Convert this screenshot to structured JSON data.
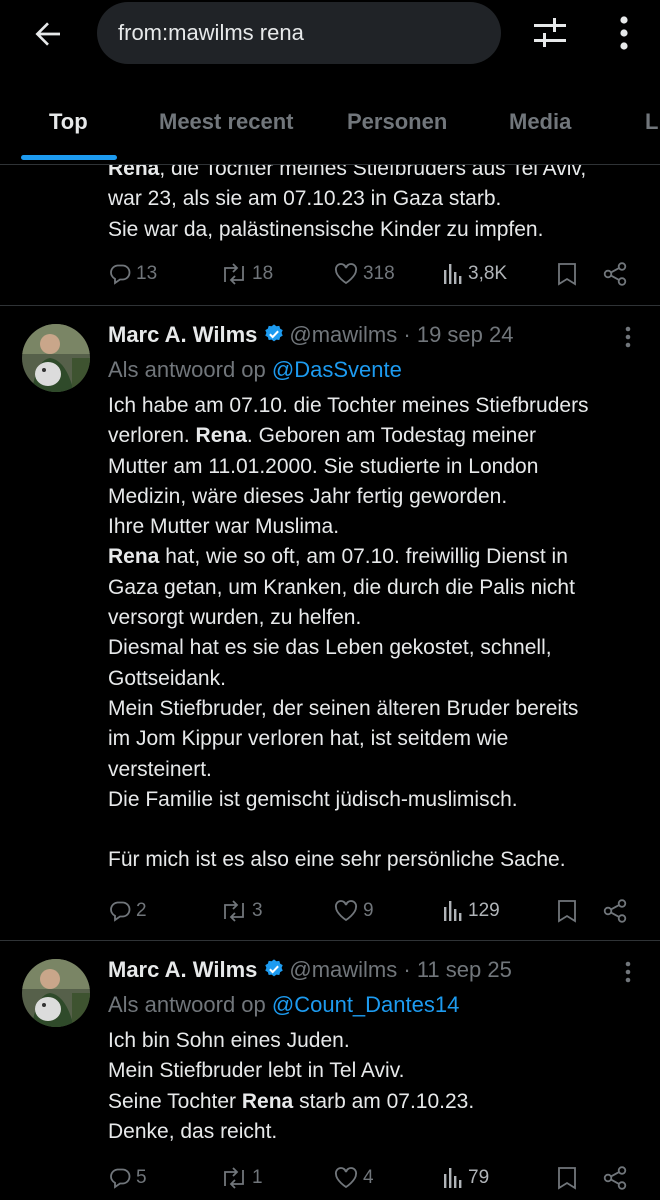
{
  "search": {
    "query": "from:mawilms rena"
  },
  "tabs": [
    {
      "label": "Top"
    },
    {
      "label": "Meest recent"
    },
    {
      "label": "Personen"
    },
    {
      "label": "Media"
    },
    {
      "label": "Li"
    }
  ],
  "tweet0": {
    "lines": [
      {
        "bold": "Rena",
        "rest": ", die Tochter meines Stiefbruders aus Tel Aviv,"
      },
      {
        "text": "war 23, als sie am 07.10.23 in Gaza starb."
      },
      {
        "text": "Sie war da, palästinensische Kinder zu impfen."
      }
    ],
    "replies": "13",
    "reposts": "18",
    "likes": "318",
    "views": "3,8K"
  },
  "tweet1": {
    "name": "Marc A. Wilms",
    "handle": "@mawilms",
    "dot": "·",
    "date": "19 sep 24",
    "reply_prefix": "Als antwoord op",
    "reply_to": "@DasSvente",
    "lines": [
      {
        "text": "Ich habe am 07.10. die Tochter meines Stiefbruders"
      },
      {
        "before": "verloren. ",
        "bold": "Rena",
        "after": ". Geboren am Todestag meiner"
      },
      {
        "text": "Mutter am 11.01.2000. Sie studierte in London"
      },
      {
        "text": "Medizin, wäre dieses Jahr fertig geworden."
      },
      {
        "text": "Ihre Mutter war Muslima."
      },
      {
        "bold": "Rena",
        "after": " hat, wie so oft, am 07.10. freiwillig Dienst in"
      },
      {
        "text": "Gaza getan, um Kranken, die durch die Palis nicht"
      },
      {
        "text": "versorgt wurden, zu helfen."
      },
      {
        "text": "Diesmal hat es sie das Leben gekostet, schnell,"
      },
      {
        "text": "Gottseidank."
      },
      {
        "text": "Mein Stiefbruder, der seinen älteren Bruder bereits"
      },
      {
        "text": "im Jom Kippur verloren hat, ist seitdem wie"
      },
      {
        "text": "versteinert."
      },
      {
        "text": "Die Familie ist gemischt jüdisch-muslimisch."
      },
      {
        "text": "Für mich ist es also eine sehr persönliche Sache."
      }
    ],
    "replies": "2",
    "reposts": "3",
    "likes": "9",
    "views": "129"
  },
  "tweet2": {
    "name": "Marc A. Wilms",
    "handle": "@mawilms",
    "dot": "·",
    "date": "11 sep 25",
    "reply_prefix": "Als antwoord op",
    "reply_to": "@Count_Dantes14",
    "lines": [
      {
        "text": "Ich bin Sohn eines Juden."
      },
      {
        "text": "Mein Stiefbruder lebt in Tel Aviv."
      },
      {
        "before": "Seine Tochter ",
        "bold": "Rena",
        "after": " starb am 07.10.23."
      },
      {
        "text": "Denke, das reicht."
      }
    ],
    "replies": "5",
    "reposts": "1",
    "likes": "4",
    "views": "79"
  },
  "colors": {
    "accent": "#1d9bf0",
    "muted": "#71767b",
    "text": "#e7e9ea",
    "background": "#000000",
    "divider": "#2f3336"
  },
  "icons": [
    "back-arrow-icon",
    "filter-icon",
    "more-vertical-icon",
    "reply-icon",
    "repost-icon",
    "like-icon",
    "views-icon",
    "bookmark-icon",
    "share-icon",
    "verified-icon"
  ]
}
